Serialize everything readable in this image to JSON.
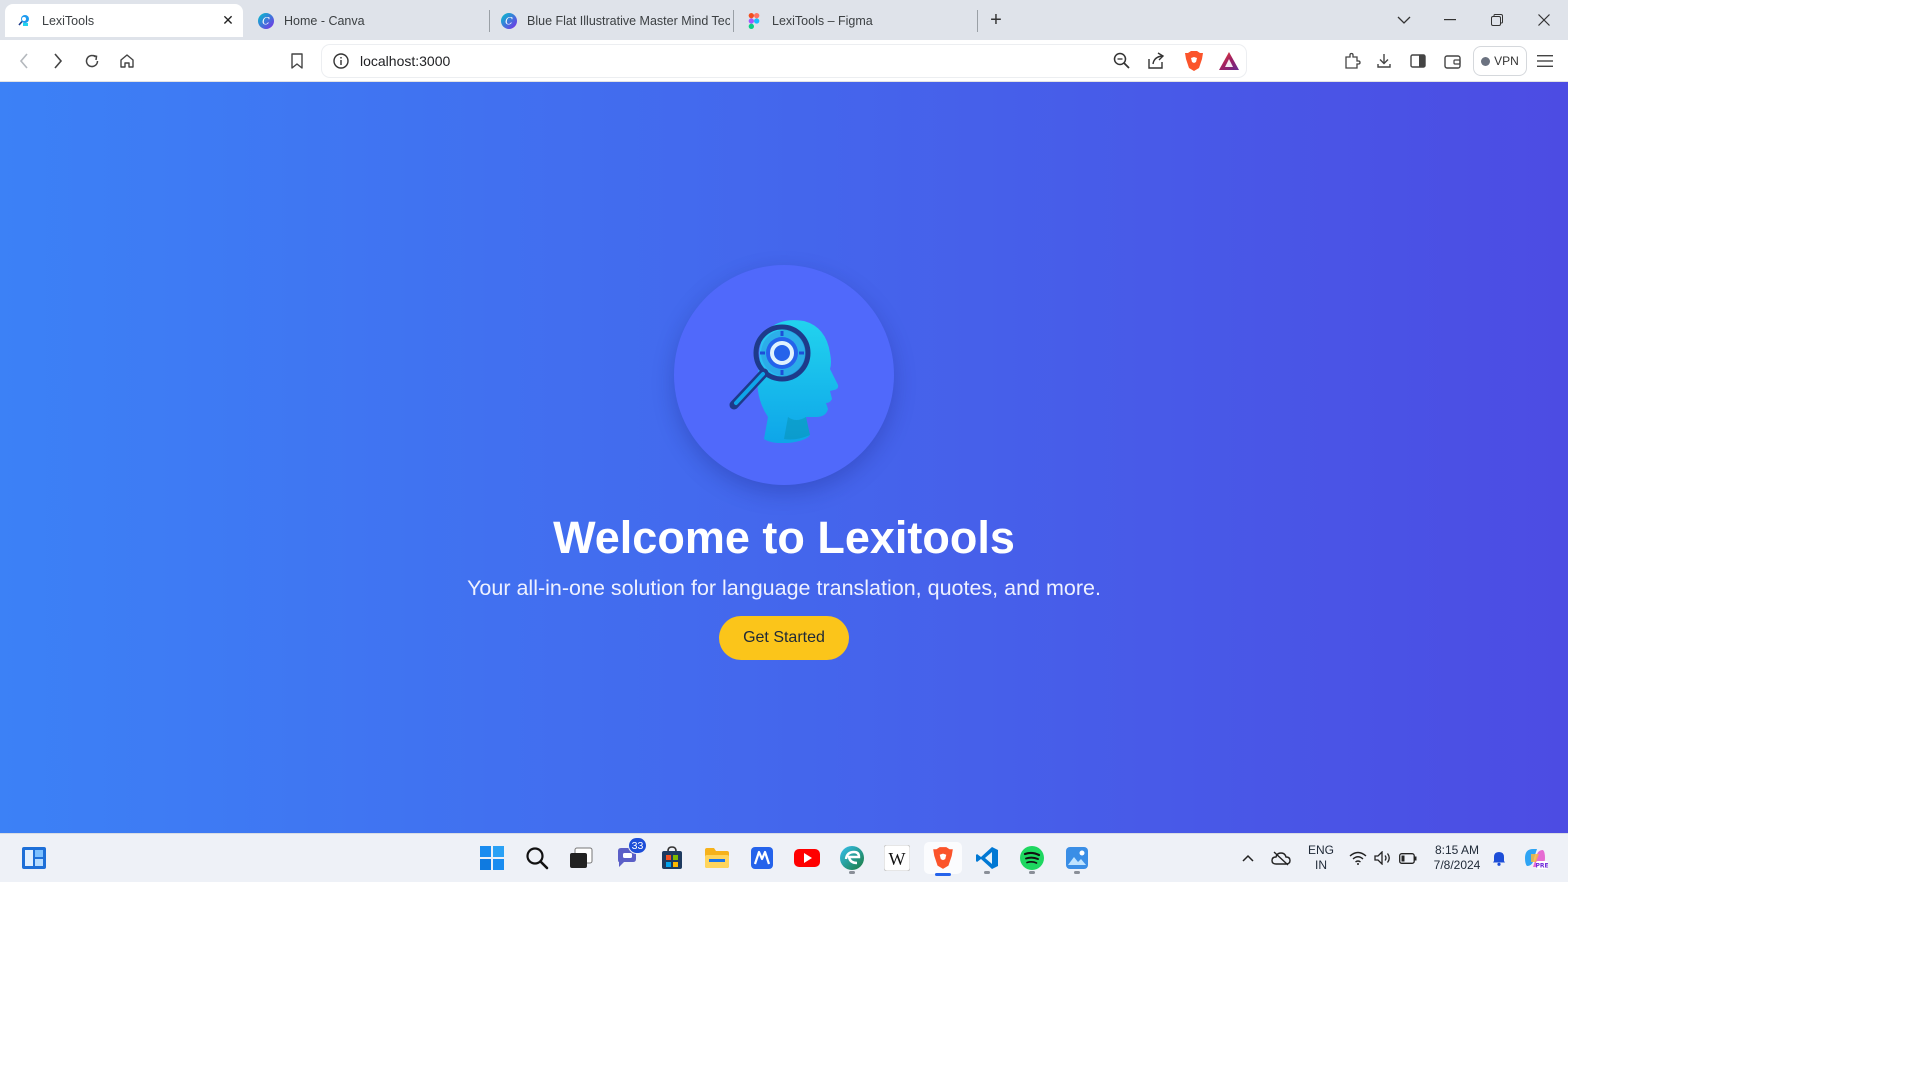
{
  "browser": {
    "tabs": [
      {
        "title": "LexiTools",
        "active": true,
        "favicon": "lexitools-favicon"
      },
      {
        "title": "Home - Canva",
        "active": false,
        "favicon": "canva-favicon"
      },
      {
        "title": "Blue Flat Illustrative Master Mind Tec",
        "active": false,
        "favicon": "canva-favicon"
      },
      {
        "title": "LexiTools – Figma",
        "active": false,
        "favicon": "figma-favicon"
      }
    ],
    "url": "localhost:3000",
    "vpn_label": "VPN"
  },
  "page": {
    "heading": "Welcome to Lexitools",
    "tagline": "Your all-in-one solution for language translation, quotes, and more.",
    "cta_label": "Get Started",
    "colors": {
      "gradient_start": "#3c81f6",
      "gradient_end": "#4c4ce3",
      "cta": "#fbc51a",
      "logo_circle": "#5069fb"
    }
  },
  "taskbar": {
    "apps": [
      "windows-start",
      "search",
      "task-view",
      "teams-chat",
      "microsoft-store",
      "file-explorer",
      "app-m",
      "youtube",
      "edge",
      "wikipedia",
      "brave",
      "vscode",
      "spotify",
      "photos"
    ],
    "chat_badge": "33",
    "language": {
      "line1": "ENG",
      "line2": "IN"
    },
    "time": "8:15 AM",
    "date": "7/8/2024"
  }
}
